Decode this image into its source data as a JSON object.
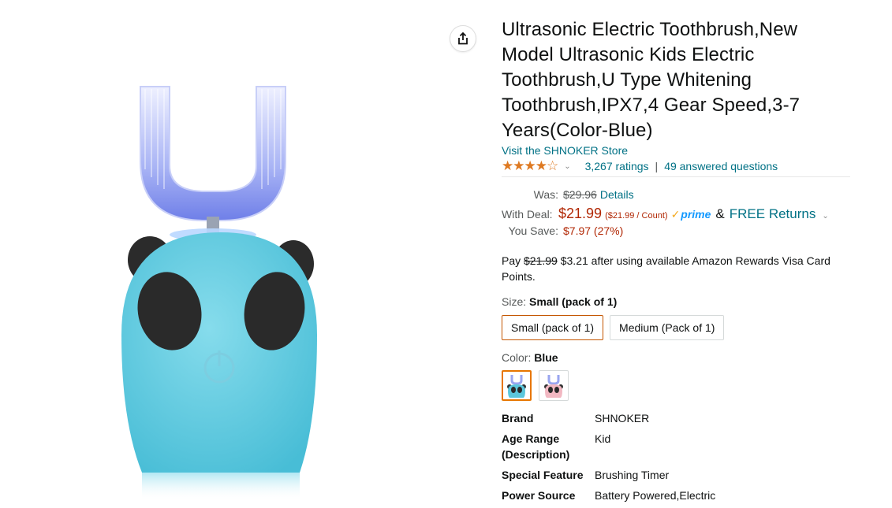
{
  "product": {
    "title": "Ultrasonic Electric Toothbrush,New Model Ultrasonic Kids Electric Toothbrush,U Type Whitening Toothbrush,IPX7,4 Gear Speed,3-7 Years(Color-Blue)",
    "store_link": "Visit the SHNOKER Store",
    "rating_stars": "★★★★☆",
    "ratings_count": "3,267 ratings",
    "answered_questions": "49 answered questions"
  },
  "pricing": {
    "was_label": "Was:",
    "was_price": "$29.96",
    "details_link": "Details",
    "deal_label": "With Deal:",
    "deal_price": "$21.99",
    "unit_price": "($21.99 / Count)",
    "prime_label": "prime",
    "amp": "&",
    "free_returns": "FREE Returns",
    "save_label": "You Save:",
    "save_amount": "$7.97 (27%)"
  },
  "pay_note": {
    "prefix": "Pay ",
    "struck": "$21.99",
    "rest": " $3.21 after using available Amazon Rewards Visa Card Points."
  },
  "size": {
    "label": "Size: ",
    "selected": "Small (pack of 1)",
    "options": [
      "Small (pack of 1)",
      "Medium (Pack of 1)"
    ]
  },
  "color": {
    "label": "Color: ",
    "selected": "Blue",
    "swatches": [
      "blue",
      "pink"
    ]
  },
  "specs": [
    {
      "key": "Brand",
      "value": "SHNOKER"
    },
    {
      "key": "Age Range (Description)",
      "value": "Kid"
    },
    {
      "key": "Special Feature",
      "value": "Brushing Timer"
    },
    {
      "key": "Power Source",
      "value": "Battery Powered,Electric"
    }
  ],
  "colors": {
    "link": "#007185",
    "price_red": "#b12704",
    "star_orange": "#de7921",
    "prime_blue": "#1399ff",
    "selected_border": "#c45500"
  }
}
